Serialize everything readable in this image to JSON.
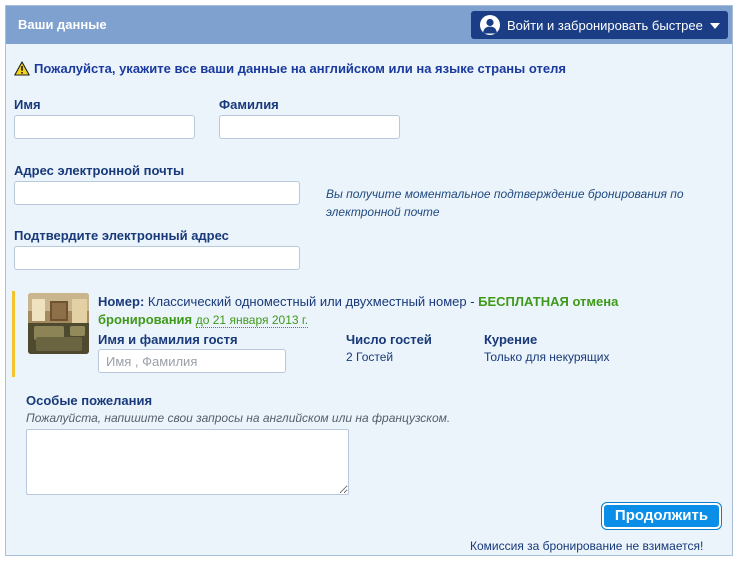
{
  "header": {
    "title": "Ваши данные",
    "login_button": "Войти и забронировать быстрее"
  },
  "warning": "Пожалуйста, укажите все ваши данные на английском или на языке страны отеля",
  "form": {
    "first_name_label": "Имя",
    "first_name_value": "",
    "last_name_label": "Фамилия",
    "last_name_value": "",
    "email_label": "Адрес электронной почты",
    "email_value": "",
    "email_hint": "Вы получите моментальное подтверждение бронирования по электронной почте",
    "confirm_email_label": "Подтвердите электронный адрес",
    "confirm_email_value": ""
  },
  "room": {
    "key_label": "Номер:",
    "name": "Классический одноместный или двухместный номер",
    "separator": " - ",
    "free_cancel": "БЕСПЛАТНАЯ отмена бронирования",
    "until": "до 21 января 2013 г.",
    "guest_name_label": "Имя и фамилия гостя",
    "guest_name_placeholder": "Имя , Фамилия",
    "guests_label": "Число гостей",
    "guests_value": "2 Гостей",
    "smoking_label": "Курение",
    "smoking_value": "Только для некурящих"
  },
  "requests": {
    "title": "Особые пожелания",
    "hint": "Пожалуйста, напишите свои запросы на английском или на французском.",
    "value": ""
  },
  "continue_button": "Продолжить",
  "footer_note": "Комиссия за бронирование не взимается!",
  "colors": {
    "header_bg": "#7fa1cf",
    "login_bg": "#1a3d86",
    "panel_bg": "#ebf3fb",
    "label_text": "#183a7a",
    "free_cancel_green": "#3e9a1a",
    "continue_bg": "#0a8ee8",
    "room_accent": "#f4c430"
  },
  "icons": {
    "login": "user-icon",
    "login_dropdown": "caret-down-icon",
    "warning": "warning-icon",
    "room": "room-photo"
  }
}
